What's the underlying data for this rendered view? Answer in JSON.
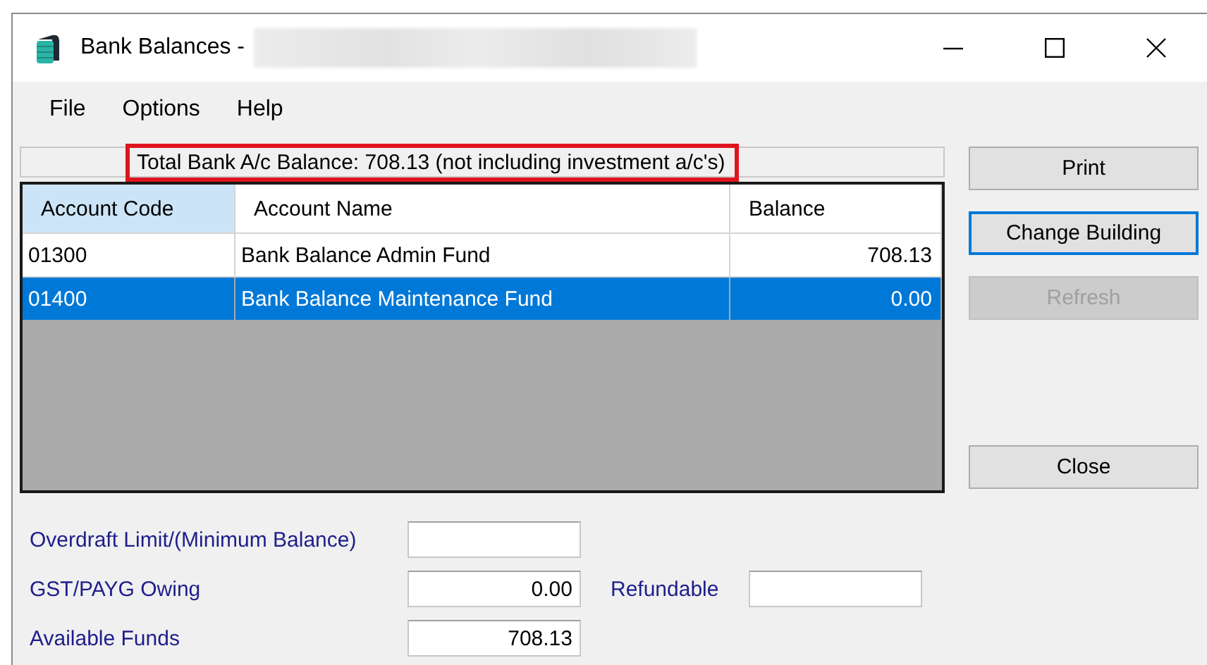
{
  "window": {
    "title": "Bank Balances -",
    "title_redacted": true
  },
  "menu": [
    "File",
    "Options",
    "Help"
  ],
  "summary": {
    "text": "Total Bank A/c Balance: 708.13 (not including investment a/c's)",
    "highlighted": true
  },
  "table": {
    "columns": [
      {
        "label": "Account Code",
        "sorted": true,
        "kind": "text"
      },
      {
        "label": "Account Name",
        "sorted": false,
        "kind": "text"
      },
      {
        "label": "Balance",
        "sorted": false,
        "kind": "amount"
      }
    ],
    "rows": [
      {
        "cells": [
          "01300",
          "Bank Balance Admin Fund",
          "708.13"
        ],
        "selected": false
      },
      {
        "cells": [
          "01400",
          "Bank Balance Maintenance Fund",
          "0.00"
        ],
        "selected": true
      }
    ]
  },
  "buttons": [
    {
      "label": "Print",
      "focused": false,
      "disabled": false
    },
    {
      "label": "Change Building",
      "focused": true,
      "disabled": false
    },
    {
      "label": "Refresh",
      "focused": false,
      "disabled": true
    },
    {
      "label": "Close",
      "focused": false,
      "disabled": false
    }
  ],
  "fields": [
    {
      "label": "Overdraft Limit/(Minimum Balance)"
    },
    {
      "label": "GST/PAYG Owing",
      "value": "0.00",
      "extra": {
        "label": "Refundable"
      }
    },
    {
      "label": "Available Funds",
      "value": "708.13"
    }
  ]
}
